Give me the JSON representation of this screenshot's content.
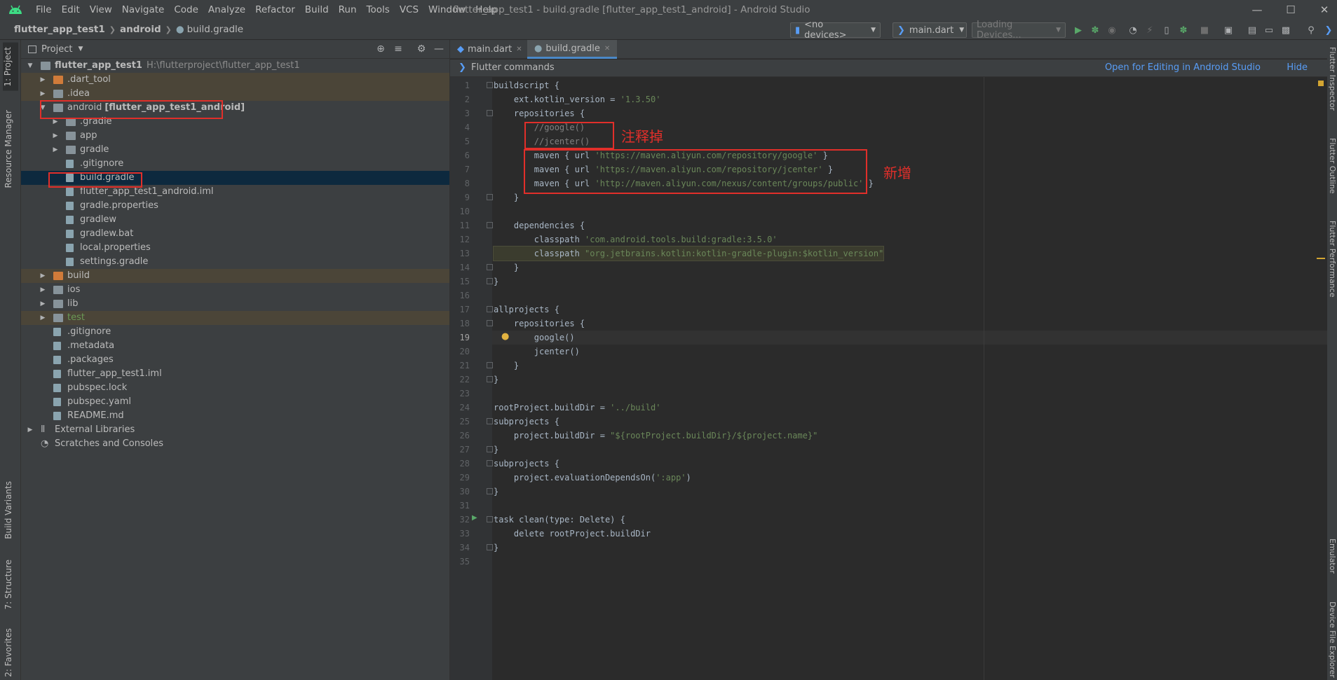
{
  "app": {
    "window_title": "flutter_app_test1 - build.gradle [flutter_app_test1_android] - Android Studio",
    "menu": [
      "File",
      "Edit",
      "View",
      "Navigate",
      "Code",
      "Analyze",
      "Refactor",
      "Build",
      "Run",
      "Tools",
      "VCS",
      "Window",
      "Help"
    ]
  },
  "breadcrumb": [
    "flutter_app_test1",
    "android",
    "build.gradle"
  ],
  "toolbar": {
    "device_combo": "<no devices>",
    "run_config": "main.dart",
    "loading_devices": "Loading Devices..."
  },
  "left_stripe": {
    "project": "1: Project",
    "resource_manager": "Resource Manager",
    "build_variants": "Build Variants",
    "structure": "7: Structure",
    "favorites": "2: Favorites"
  },
  "project_panel": {
    "title": "Project",
    "tree": [
      {
        "label": "flutter_app_test1",
        "path": "H:\\flutterproject\\flutter_app_test1"
      },
      {
        "label": ".dart_tool"
      },
      {
        "label": ".idea"
      },
      {
        "label": "android",
        "module": "[flutter_app_test1_android]"
      },
      {
        "label": ".gradle"
      },
      {
        "label": "app"
      },
      {
        "label": "gradle"
      },
      {
        "label": ".gitignore"
      },
      {
        "label": "build.gradle"
      },
      {
        "label": "flutter_app_test1_android.iml"
      },
      {
        "label": "gradle.properties"
      },
      {
        "label": "gradlew"
      },
      {
        "label": "gradlew.bat"
      },
      {
        "label": "local.properties"
      },
      {
        "label": "settings.gradle"
      },
      {
        "label": "build"
      },
      {
        "label": "ios"
      },
      {
        "label": "lib"
      },
      {
        "label": "test"
      },
      {
        "label": ".gitignore"
      },
      {
        "label": ".metadata"
      },
      {
        "label": ".packages"
      },
      {
        "label": "flutter_app_test1.iml"
      },
      {
        "label": "pubspec.lock"
      },
      {
        "label": "pubspec.yaml"
      },
      {
        "label": "README.md"
      },
      {
        "label": "External Libraries"
      },
      {
        "label": "Scratches and Consoles"
      }
    ]
  },
  "editor": {
    "tabs": [
      "main.dart",
      "build.gradle"
    ],
    "active_tab": "build.gradle",
    "notification": {
      "text": "Flutter commands",
      "open_link": "Open for Editing in Android Studio",
      "hide_link": "Hide"
    },
    "current_line": 19,
    "lines": [
      {
        "n": "1",
        "t": "buildscript {"
      },
      {
        "n": "2",
        "t": "    ext.kotlin_version = '1.3.50'"
      },
      {
        "n": "3",
        "t": "    repositories {"
      },
      {
        "n": "4",
        "t": "        //google()"
      },
      {
        "n": "5",
        "t": "        //jcenter()"
      },
      {
        "n": "6",
        "t": "        maven { url 'https://maven.aliyun.com/repository/google' }"
      },
      {
        "n": "7",
        "t": "        maven { url 'https://maven.aliyun.com/repository/jcenter' }"
      },
      {
        "n": "8",
        "t": "        maven { url 'http://maven.aliyun.com/nexus/content/groups/public' }"
      },
      {
        "n": "9",
        "t": "    }"
      },
      {
        "n": "10",
        "t": ""
      },
      {
        "n": "11",
        "t": "    dependencies {"
      },
      {
        "n": "12",
        "t": "        classpath 'com.android.tools.build:gradle:3.5.0'"
      },
      {
        "n": "13",
        "t": "        classpath \"org.jetbrains.kotlin:kotlin-gradle-plugin:$kotlin_version\""
      },
      {
        "n": "14",
        "t": "    }"
      },
      {
        "n": "15",
        "t": "}"
      },
      {
        "n": "16",
        "t": ""
      },
      {
        "n": "17",
        "t": "allprojects {"
      },
      {
        "n": "18",
        "t": "    repositories {"
      },
      {
        "n": "19",
        "t": "        google()"
      },
      {
        "n": "20",
        "t": "        jcenter()"
      },
      {
        "n": "21",
        "t": "    }"
      },
      {
        "n": "22",
        "t": "}"
      },
      {
        "n": "23",
        "t": ""
      },
      {
        "n": "24",
        "t": "rootProject.buildDir = '../build'"
      },
      {
        "n": "25",
        "t": "subprojects {"
      },
      {
        "n": "26",
        "t": "    project.buildDir = \"${rootProject.buildDir}/${project.name}\""
      },
      {
        "n": "27",
        "t": "}"
      },
      {
        "n": "28",
        "t": "subprojects {"
      },
      {
        "n": "29",
        "t": "    project.evaluationDependsOn(':app')"
      },
      {
        "n": "30",
        "t": "}"
      },
      {
        "n": "31",
        "t": ""
      },
      {
        "n": "32",
        "t": "task clean(type: Delete) {"
      },
      {
        "n": "33",
        "t": "    delete rootProject.buildDir"
      },
      {
        "n": "34",
        "t": "}"
      },
      {
        "n": "35",
        "t": ""
      }
    ]
  },
  "right_stripe": {
    "flutter_inspector": "Flutter Inspector",
    "flutter_outline": "Flutter Outline",
    "flutter_performance": "Flutter Performance",
    "emulator": "Emulator",
    "device_file_explorer": "Device File Explorer"
  },
  "annotations": {
    "commented_out": "注释掉",
    "added": "新增",
    "color": "#e12f2a"
  }
}
